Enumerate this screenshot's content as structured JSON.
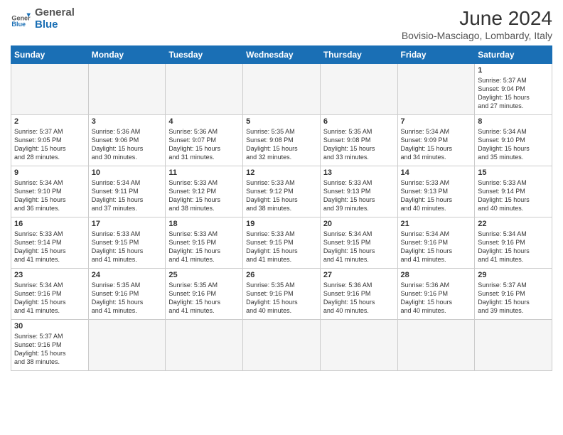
{
  "header": {
    "logo_general": "General",
    "logo_blue": "Blue",
    "title": "June 2024",
    "subtitle": "Bovisio-Masciago, Lombardy, Italy"
  },
  "days_of_week": [
    "Sunday",
    "Monday",
    "Tuesday",
    "Wednesday",
    "Thursday",
    "Friday",
    "Saturday"
  ],
  "weeks": [
    [
      {
        "day": "",
        "info": ""
      },
      {
        "day": "",
        "info": ""
      },
      {
        "day": "",
        "info": ""
      },
      {
        "day": "",
        "info": ""
      },
      {
        "day": "",
        "info": ""
      },
      {
        "day": "",
        "info": ""
      },
      {
        "day": "1",
        "info": "Sunrise: 5:37 AM\nSunset: 9:04 PM\nDaylight: 15 hours\nand 27 minutes."
      }
    ],
    [
      {
        "day": "2",
        "info": "Sunrise: 5:37 AM\nSunset: 9:05 PM\nDaylight: 15 hours\nand 28 minutes."
      },
      {
        "day": "3",
        "info": "Sunrise: 5:36 AM\nSunset: 9:06 PM\nDaylight: 15 hours\nand 30 minutes."
      },
      {
        "day": "4",
        "info": "Sunrise: 5:36 AM\nSunset: 9:07 PM\nDaylight: 15 hours\nand 31 minutes."
      },
      {
        "day": "5",
        "info": "Sunrise: 5:35 AM\nSunset: 9:08 PM\nDaylight: 15 hours\nand 32 minutes."
      },
      {
        "day": "6",
        "info": "Sunrise: 5:35 AM\nSunset: 9:08 PM\nDaylight: 15 hours\nand 33 minutes."
      },
      {
        "day": "7",
        "info": "Sunrise: 5:34 AM\nSunset: 9:09 PM\nDaylight: 15 hours\nand 34 minutes."
      },
      {
        "day": "8",
        "info": "Sunrise: 5:34 AM\nSunset: 9:10 PM\nDaylight: 15 hours\nand 35 minutes."
      }
    ],
    [
      {
        "day": "9",
        "info": "Sunrise: 5:34 AM\nSunset: 9:10 PM\nDaylight: 15 hours\nand 36 minutes."
      },
      {
        "day": "10",
        "info": "Sunrise: 5:34 AM\nSunset: 9:11 PM\nDaylight: 15 hours\nand 37 minutes."
      },
      {
        "day": "11",
        "info": "Sunrise: 5:33 AM\nSunset: 9:12 PM\nDaylight: 15 hours\nand 38 minutes."
      },
      {
        "day": "12",
        "info": "Sunrise: 5:33 AM\nSunset: 9:12 PM\nDaylight: 15 hours\nand 38 minutes."
      },
      {
        "day": "13",
        "info": "Sunrise: 5:33 AM\nSunset: 9:13 PM\nDaylight: 15 hours\nand 39 minutes."
      },
      {
        "day": "14",
        "info": "Sunrise: 5:33 AM\nSunset: 9:13 PM\nDaylight: 15 hours\nand 40 minutes."
      },
      {
        "day": "15",
        "info": "Sunrise: 5:33 AM\nSunset: 9:14 PM\nDaylight: 15 hours\nand 40 minutes."
      }
    ],
    [
      {
        "day": "16",
        "info": "Sunrise: 5:33 AM\nSunset: 9:14 PM\nDaylight: 15 hours\nand 41 minutes."
      },
      {
        "day": "17",
        "info": "Sunrise: 5:33 AM\nSunset: 9:15 PM\nDaylight: 15 hours\nand 41 minutes."
      },
      {
        "day": "18",
        "info": "Sunrise: 5:33 AM\nSunset: 9:15 PM\nDaylight: 15 hours\nand 41 minutes."
      },
      {
        "day": "19",
        "info": "Sunrise: 5:33 AM\nSunset: 9:15 PM\nDaylight: 15 hours\nand 41 minutes."
      },
      {
        "day": "20",
        "info": "Sunrise: 5:34 AM\nSunset: 9:15 PM\nDaylight: 15 hours\nand 41 minutes."
      },
      {
        "day": "21",
        "info": "Sunrise: 5:34 AM\nSunset: 9:16 PM\nDaylight: 15 hours\nand 41 minutes."
      },
      {
        "day": "22",
        "info": "Sunrise: 5:34 AM\nSunset: 9:16 PM\nDaylight: 15 hours\nand 41 minutes."
      }
    ],
    [
      {
        "day": "23",
        "info": "Sunrise: 5:34 AM\nSunset: 9:16 PM\nDaylight: 15 hours\nand 41 minutes."
      },
      {
        "day": "24",
        "info": "Sunrise: 5:35 AM\nSunset: 9:16 PM\nDaylight: 15 hours\nand 41 minutes."
      },
      {
        "day": "25",
        "info": "Sunrise: 5:35 AM\nSunset: 9:16 PM\nDaylight: 15 hours\nand 41 minutes."
      },
      {
        "day": "26",
        "info": "Sunrise: 5:35 AM\nSunset: 9:16 PM\nDaylight: 15 hours\nand 40 minutes."
      },
      {
        "day": "27",
        "info": "Sunrise: 5:36 AM\nSunset: 9:16 PM\nDaylight: 15 hours\nand 40 minutes."
      },
      {
        "day": "28",
        "info": "Sunrise: 5:36 AM\nSunset: 9:16 PM\nDaylight: 15 hours\nand 40 minutes."
      },
      {
        "day": "29",
        "info": "Sunrise: 5:37 AM\nSunset: 9:16 PM\nDaylight: 15 hours\nand 39 minutes."
      }
    ],
    [
      {
        "day": "30",
        "info": "Sunrise: 5:37 AM\nSunset: 9:16 PM\nDaylight: 15 hours\nand 38 minutes."
      },
      {
        "day": "",
        "info": ""
      },
      {
        "day": "",
        "info": ""
      },
      {
        "day": "",
        "info": ""
      },
      {
        "day": "",
        "info": ""
      },
      {
        "day": "",
        "info": ""
      },
      {
        "day": "",
        "info": ""
      }
    ]
  ]
}
